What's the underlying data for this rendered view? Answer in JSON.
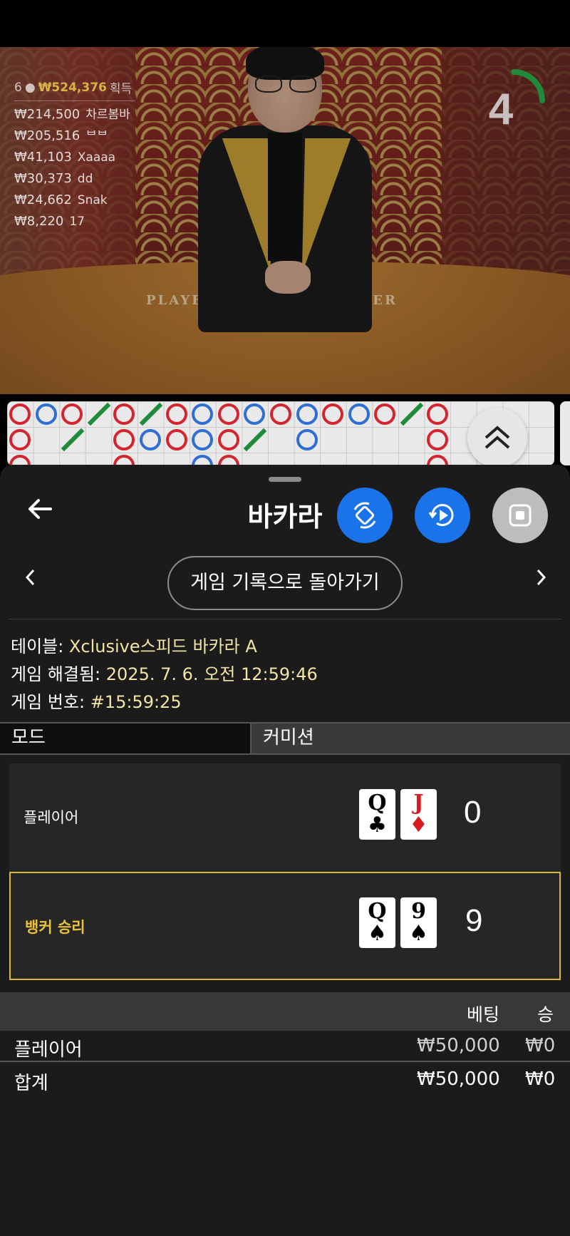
{
  "winners": {
    "header": {
      "count": "6",
      "amount": "₩524,376",
      "suffix": "획득"
    },
    "rows": [
      {
        "amount": "₩214,500",
        "name": "차르봄바"
      },
      {
        "amount": "₩205,516",
        "name": "ᄇᄇ"
      },
      {
        "amount": "₩41,103",
        "name": "Xaaaa"
      },
      {
        "amount": "₩30,373",
        "name": "dd"
      },
      {
        "amount": "₩24,662",
        "name": "Snak"
      },
      {
        "amount": "₩8,220",
        "name": "17"
      }
    ]
  },
  "video": {
    "player_text": "PLAYER",
    "banker_text": "BANKER",
    "timer": "4",
    "timer_progress": 0.25
  },
  "sheet": {
    "title": "바카라",
    "history_button": "게임 기록으로 돌아가기",
    "info": {
      "table_label": "테이블:",
      "table_value": "Xclusive스피드 바카라 A",
      "resolved_label": "게임 해결됨:",
      "resolved_value": "2025. 7. 6. 오전 12:59:46",
      "number_label": "게임 번호:",
      "number_value": "#15:59:25"
    },
    "tabs": {
      "mode": "모드",
      "commission": "커미션"
    },
    "results": {
      "player": {
        "label": "플레이어",
        "cards": [
          {
            "rank": "Q",
            "suit": "♣"
          },
          {
            "rank": "J",
            "suit": "♦"
          }
        ],
        "score": "0"
      },
      "banker": {
        "label": "뱅커 승리",
        "cards": [
          {
            "rank": "Q",
            "suit": "♠"
          },
          {
            "rank": "9",
            "suit": "♠"
          }
        ],
        "score": "9"
      }
    },
    "bets": {
      "header_bet": "베팅",
      "header_win": "승",
      "rows": [
        {
          "label": "플레이어",
          "bet": "₩50,000",
          "win": "₩0"
        },
        {
          "label": "합계",
          "bet": "₩50,000",
          "win": "₩0"
        }
      ]
    }
  },
  "colors": {
    "accent_blue": "#1a73e8",
    "gold": "#e9c23a",
    "banker_red": "#d3252f",
    "player_blue": "#2f6fd3",
    "tie_green": "#1f8a3a"
  },
  "icons": [
    "back-arrow-icon",
    "rotate-screen-icon",
    "replay-icon",
    "stop-icon",
    "chevron-left-icon",
    "chevron-right-icon",
    "double-chevron-up-icon"
  ]
}
